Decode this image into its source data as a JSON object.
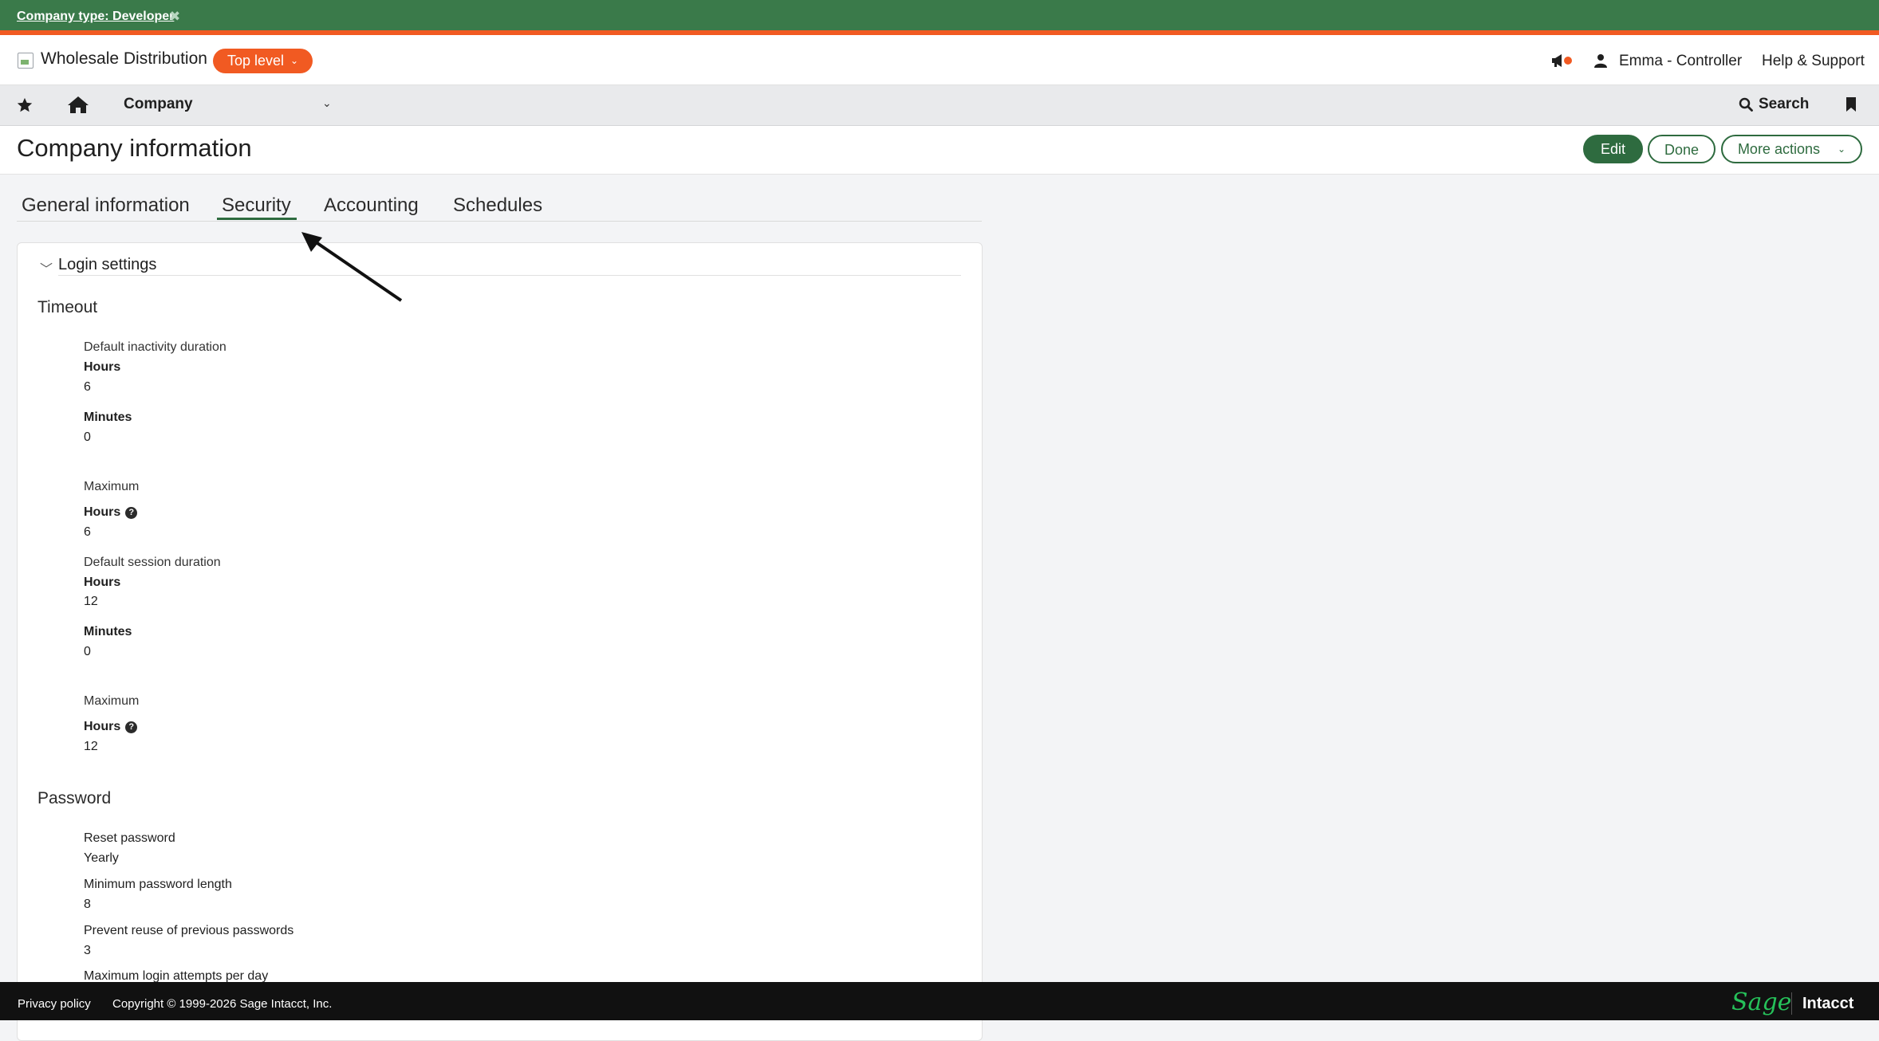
{
  "banner": {
    "label": "Company type: Developer",
    "close_icon": "close-x-icon"
  },
  "header": {
    "company_name": "Wholesale Distribution",
    "level_label": "Top level",
    "user_label": "Emma - Controller",
    "help_label": "Help & Support"
  },
  "nav": {
    "company_label": "Company",
    "search_label": "Search"
  },
  "page": {
    "title": "Company information",
    "actions": {
      "edit": "Edit",
      "done": "Done",
      "more": "More actions"
    }
  },
  "tabs": [
    {
      "label": "General information"
    },
    {
      "label": "Security",
      "active": true
    },
    {
      "label": "Accounting"
    },
    {
      "label": "Schedules"
    }
  ],
  "login_settings": {
    "title": "Login settings",
    "timeout": {
      "heading": "Timeout",
      "inactivity": {
        "label": "Default inactivity duration",
        "hours_label": "Hours",
        "hours": "6",
        "minutes_label": "Minutes",
        "minutes": "0",
        "max_label": "Maximum",
        "max_hours_label": "Hours",
        "max_hours": "6"
      },
      "session": {
        "label": "Default session duration",
        "hours_label": "Hours",
        "hours": "12",
        "minutes_label": "Minutes",
        "minutes": "0",
        "max_label": "Maximum",
        "max_hours_label": "Hours",
        "max_hours": "12"
      }
    },
    "password": {
      "heading": "Password",
      "reset_label": "Reset password",
      "reset": "Yearly",
      "min_length_label": "Minimum password length",
      "min_length": "8",
      "reuse_label": "Prevent reuse of previous passwords",
      "reuse": "3",
      "max_attempts_label": "Maximum login attempts per day"
    }
  },
  "footer": {
    "privacy": "Privacy policy",
    "copyright": "Copyright © 1999-2026 Sage Intacct, Inc.",
    "brand": "Sage",
    "product": "Intacct"
  },
  "colors": {
    "brand_green": "#2e6b3f",
    "accent_orange": "#f15a22",
    "banner_green": "#3a7a4a",
    "sage_green": "#26c15a"
  }
}
